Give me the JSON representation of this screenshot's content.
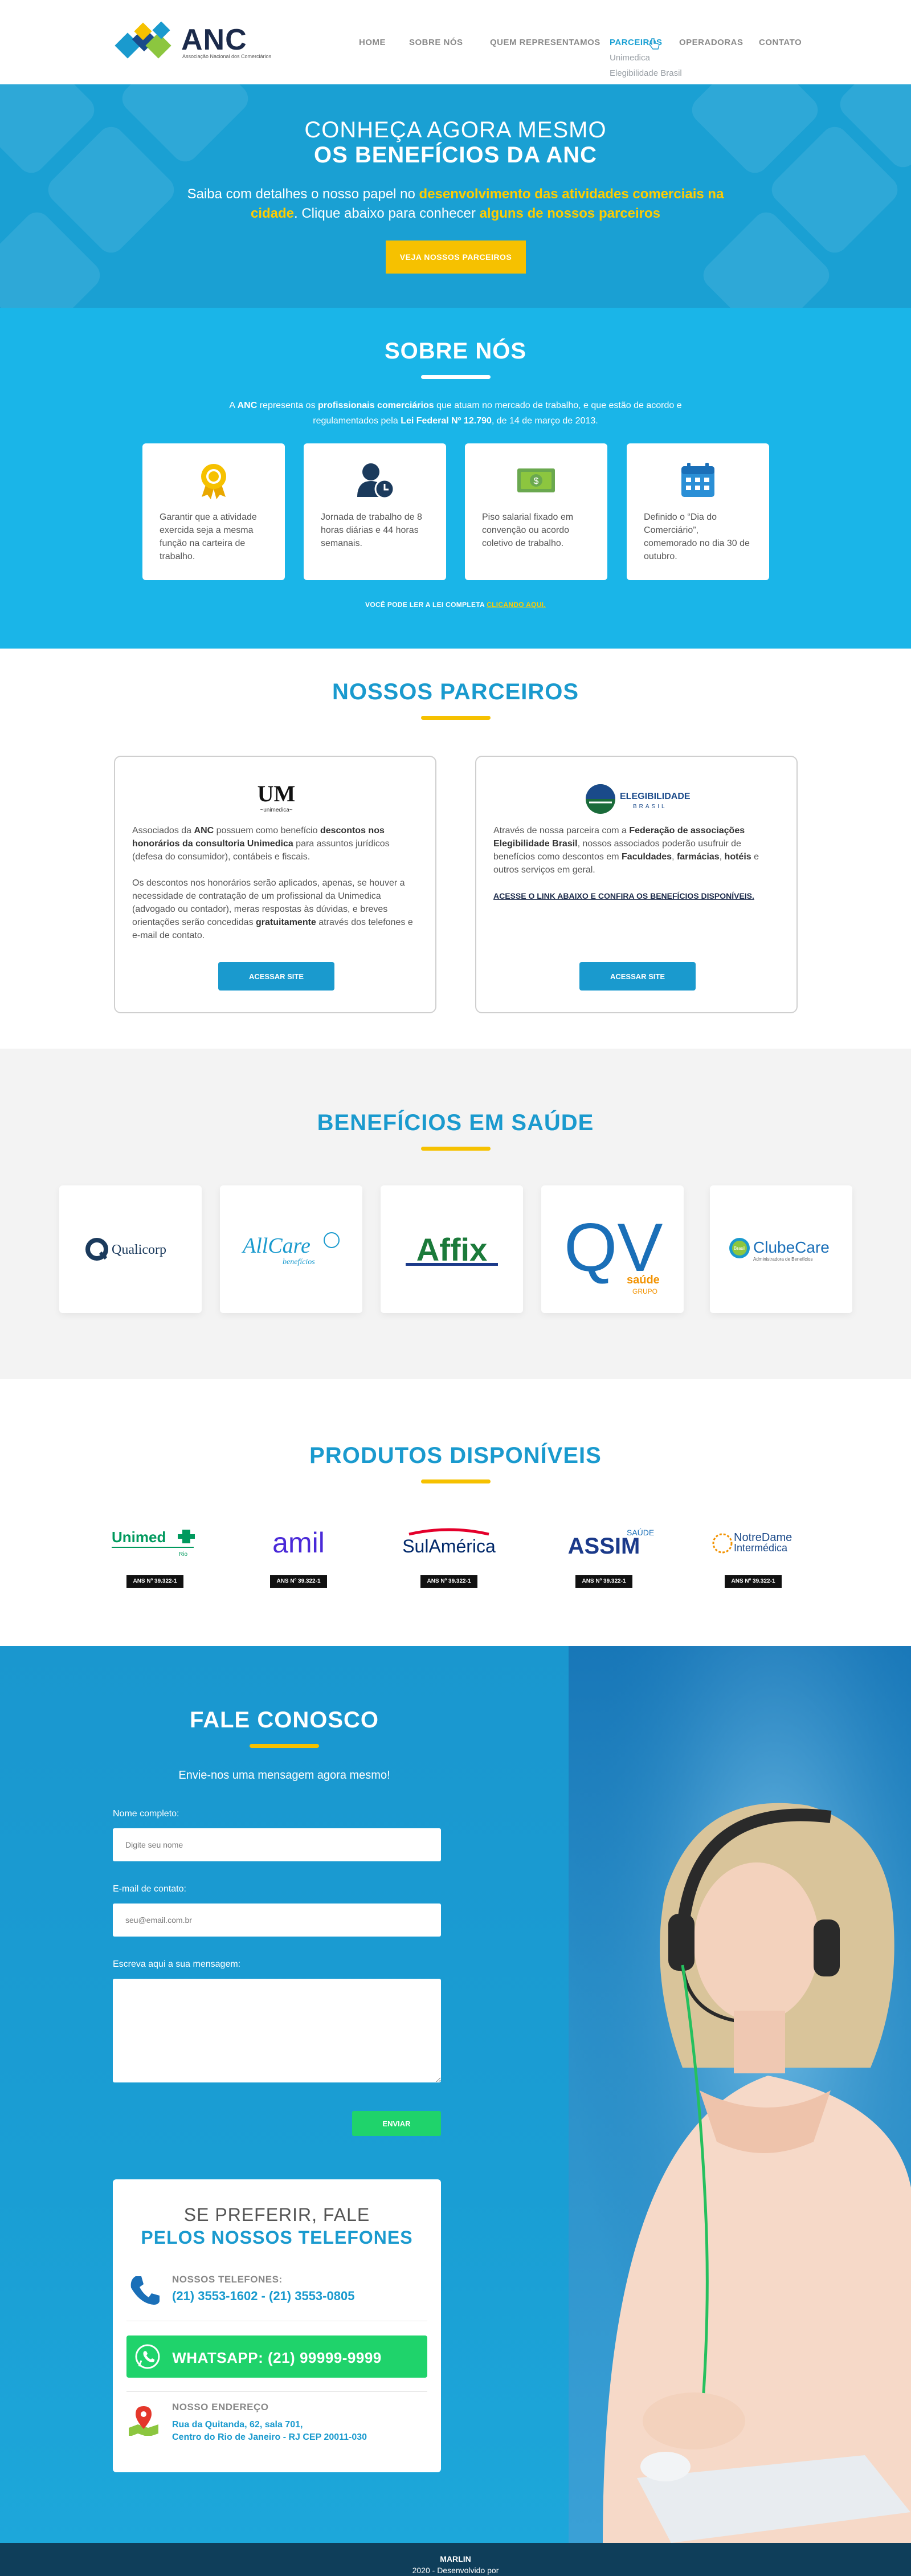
{
  "header": {
    "logo_text": "ANC",
    "logo_sub": "Associação Nacional dos Comerciários",
    "nav": [
      {
        "label": "HOME"
      },
      {
        "label": "SOBRE NÓS"
      },
      {
        "label": "QUEM REPRESENTAMOS"
      },
      {
        "label": "PARCEIROS"
      },
      {
        "label": "OPERADORAS"
      },
      {
        "label": "CONTATO"
      }
    ],
    "submenu": [
      "Unimedica",
      "Elegibilidade Brasil"
    ]
  },
  "hero": {
    "line1": "CONHEÇA AGORA MESMO",
    "line2": "OS BENEFÍCIOS DA ANC",
    "text_a": "Saiba com detalhes o nosso papel no ",
    "text_b": "desenvolvimento das atividades comerciais na cidade",
    "text_c": ". Clique abaixo para conhecer ",
    "text_d": "alguns de nossos parceiros",
    "button": "VEJA NOSSOS PARCEIROS"
  },
  "sobre": {
    "title": "SOBRE NÓS",
    "p_a": "A ",
    "p_b": "ANC",
    "p_c": " representa os ",
    "p_d": "profissionais comerciários",
    "p_e": " que atuam no mercado de trabalho, e que estão de acordo e regulamentados pela ",
    "p_f": "Lei Federal Nº 12.790",
    "p_g": ", de 14 de março de 2013.",
    "cards": [
      {
        "icon": "award-icon",
        "text": "Garantir que a atividade exercida seja a mesma função na carteira de trabalho."
      },
      {
        "icon": "user-clock-icon",
        "text": "Jornada de trabalho de 8 horas diárias e 44 horas semanais."
      },
      {
        "icon": "money-icon",
        "text": "Piso salarial fixado em convenção ou acordo coletivo de trabalho."
      },
      {
        "icon": "calendar-icon",
        "text": "Definido o “Dia do Comerciário”, comemorado no dia 30 de outubro."
      }
    ],
    "lei_text": "VOCÊ PODE LER A LEI COMPLETA ",
    "lei_link": "CLICANDO AQUI."
  },
  "parceiros": {
    "title": "NOSSOS PARCEIROS",
    "unimedica": {
      "logo_text": "UM",
      "logo_sub": "~unimedica~",
      "p1_a": "Associados da ",
      "p1_b": "ANC",
      "p1_c": " possuem como benefício ",
      "p1_d": "descontos nos honorários da consultoria Unimedica",
      "p1_e": " para assuntos jurídicos (defesa do consumidor), contábeis e fiscais.",
      "p2_a": "Os descontos nos honorários serão aplicados, apenas,  se houver a necessidade de contratação de um profissional da Unimedica (advogado ou contador), meras respostas às dúvidas, e breves orientações serão concedidas  ",
      "p2_b": "gratuitamente",
      "p2_c": " através dos telefones e e-mail de contato.",
      "button": "ACESSAR SITE"
    },
    "elegibilidade": {
      "logo_text": "ELEGIBILIDADE",
      "logo_sub": "BRASIL",
      "p1_a": "Através de nossa parceira com a ",
      "p1_b": "Federação de associações Elegibilidade Brasil",
      "p1_c": ", nossos associados poderão usufruir de benefícios como descontos em ",
      "p1_d": "Faculdades",
      "p1_e": ", ",
      "p1_f": "farmácias",
      "p1_g": ", ",
      "p1_h": "hotéis",
      "p1_i": " e outros serviços em geral.",
      "link": "ACESSE O LINK ABAIXO E CONFIRA OS BENEFÍCIOS DISPONÍVEIS.",
      "button": "ACESSAR SITE"
    }
  },
  "saude": {
    "title": "BENEFÍCIOS EM SAÚDE",
    "logos": [
      {
        "name": "Qualicorp"
      },
      {
        "name": "AllCare",
        "sub": "benefícios"
      },
      {
        "name": "Affix"
      },
      {
        "name": "QV",
        "sub": "saúde",
        "sub2": "GRUPO"
      },
      {
        "name": "ClubeCare",
        "sub": "Administradora de Benefícios",
        "badge": "Brasil"
      }
    ]
  },
  "produtos": {
    "title": "PRODUTOS DISPONÍVEIS",
    "items": [
      {
        "name": "Unimed",
        "sub": "Rio",
        "ans": "ANS Nº 39.322-1"
      },
      {
        "name": "amil",
        "ans": "ANS Nº 39.322-1"
      },
      {
        "name": "SulAmérica",
        "ans": "ANS Nº 39.322-1"
      },
      {
        "name": "ASSIM",
        "sub": "SAÚDE",
        "ans": "ANS Nº 39.322-1"
      },
      {
        "name": "NotreDame",
        "sub": "Intermédica",
        "ans": "ANS Nº 39.322-1"
      }
    ]
  },
  "contato": {
    "title": "FALE CONOSCO",
    "lead": "Envie-nos uma mensagem agora mesmo!",
    "name_label": "Nome completo:",
    "name_placeholder": "Digite seu nome",
    "email_label": "E-mail de contato:",
    "email_placeholder": "seu@email.com.br",
    "msg_label": "Escreva aqui a sua mensagem:",
    "send": "ENVIAR",
    "phones_title1": "SE PREFERIR, FALE",
    "phones_title2": "PELOS NOSSOS TELEFONES",
    "tel_label": "NOSSOS TELEFONES:",
    "tel_value": "(21) 3553-1602 - (21) 3553-0805",
    "whatsapp": "WHATSAPP: (21) 99999-9999",
    "addr_label": "NOSSO ENDEREÇO",
    "addr_line1": "Rua da Quitanda, 62, sala 701,",
    "addr_line2": "Centro do Rio de Janeiro - RJ CEP 20011-030"
  },
  "footer": {
    "text": "2020 - Desenvolvido por ",
    "brand": "MARLIN"
  },
  "colors": {
    "primary": "#1aa0d3",
    "light_blue": "#1ab5e8",
    "yellow": "#f6c100",
    "green": "#1fd36b",
    "navy": "#1b2a4a",
    "footer": "#0f3e5a"
  }
}
